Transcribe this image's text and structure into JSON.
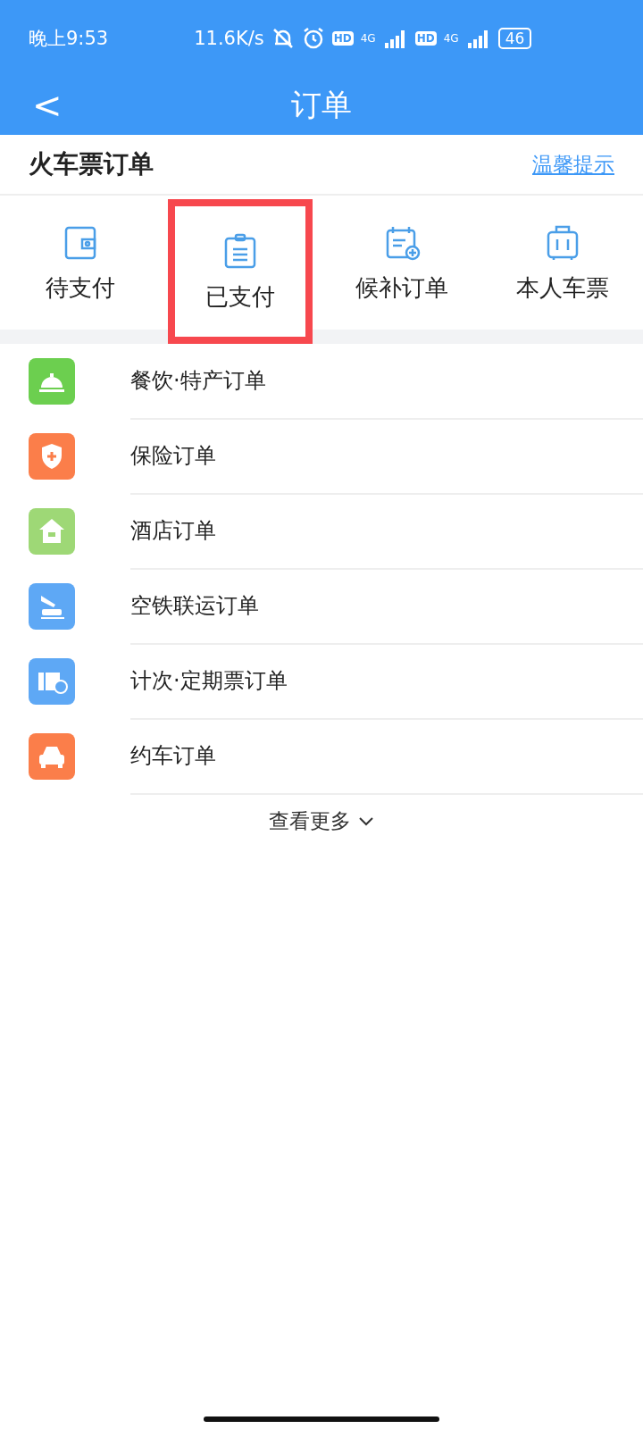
{
  "status_bar": {
    "time": "晚上9:53",
    "speed": "11.6K/s",
    "sims": [
      {
        "hd": "HD",
        "net": "4G"
      },
      {
        "hd": "HD",
        "net": "4G"
      }
    ],
    "battery": "46"
  },
  "header": {
    "back": "<",
    "title": "订单"
  },
  "section": {
    "title": "火车票订单",
    "link": "温馨提示"
  },
  "tabs": [
    {
      "label": "待支付",
      "kind": "wallet",
      "highlighted": false
    },
    {
      "label": "已支付",
      "kind": "clipboard",
      "highlighted": true
    },
    {
      "label": "候补订单",
      "kind": "calendar",
      "highlighted": false
    },
    {
      "label": "本人车票",
      "kind": "suitcase",
      "highlighted": false
    }
  ],
  "items": [
    {
      "label": "餐饮·特产订单",
      "kind": "bell",
      "color": "#6ccf4f"
    },
    {
      "label": "保险订单",
      "kind": "shield",
      "color": "#fb7e4a"
    },
    {
      "label": "酒店订单",
      "kind": "house",
      "color": "#9ed876"
    },
    {
      "label": "空铁联运订单",
      "kind": "plane",
      "color": "#5ea8f5"
    },
    {
      "label": "计次·定期票订单",
      "kind": "ticket",
      "color": "#5ea8f5"
    },
    {
      "label": "约车订单",
      "kind": "car",
      "color": "#fb7e4a"
    }
  ],
  "more": "查看更多"
}
